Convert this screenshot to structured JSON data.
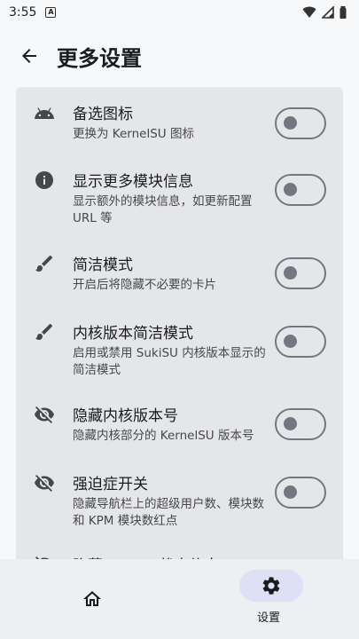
{
  "status_bar": {
    "time": "3:55",
    "app_badge": "A"
  },
  "header": {
    "title": "更多设置"
  },
  "settings": [
    {
      "title": "备选图标",
      "subtitle": "更换为 KernelSU 图标",
      "icon": "android-icon",
      "enabled": false
    },
    {
      "title": "显示更多模块信息",
      "subtitle": "显示额外的模块信息，如更新配置 URL 等",
      "icon": "info-icon",
      "enabled": false
    },
    {
      "title": "简洁模式",
      "subtitle": "开启后将隐藏不必要的卡片",
      "icon": "brush-icon",
      "enabled": false
    },
    {
      "title": "内核版本简洁模式",
      "subtitle": "启用或禁用 SukiSU 内核版本显示的简洁模式",
      "icon": "brush-icon",
      "enabled": false
    },
    {
      "title": "隐藏内核版本号",
      "subtitle": "隐藏内核部分的 KernelSU 版本号",
      "icon": "visibility-off-icon",
      "enabled": false
    },
    {
      "title": "强迫症开关",
      "subtitle": "隐藏导航栏上的超级用户数、模块数和 KPM 模块数红点",
      "icon": "visibility-off-icon",
      "enabled": false
    },
    {
      "title": "隐藏 SuSFS 状态信息",
      "subtitle": "",
      "icon": "visibility-off-icon",
      "enabled": false
    }
  ],
  "nav": {
    "items": [
      {
        "icon": "home-icon",
        "label": "",
        "active": false
      },
      {
        "icon": "gear-icon",
        "label": "设置",
        "active": true
      }
    ]
  }
}
